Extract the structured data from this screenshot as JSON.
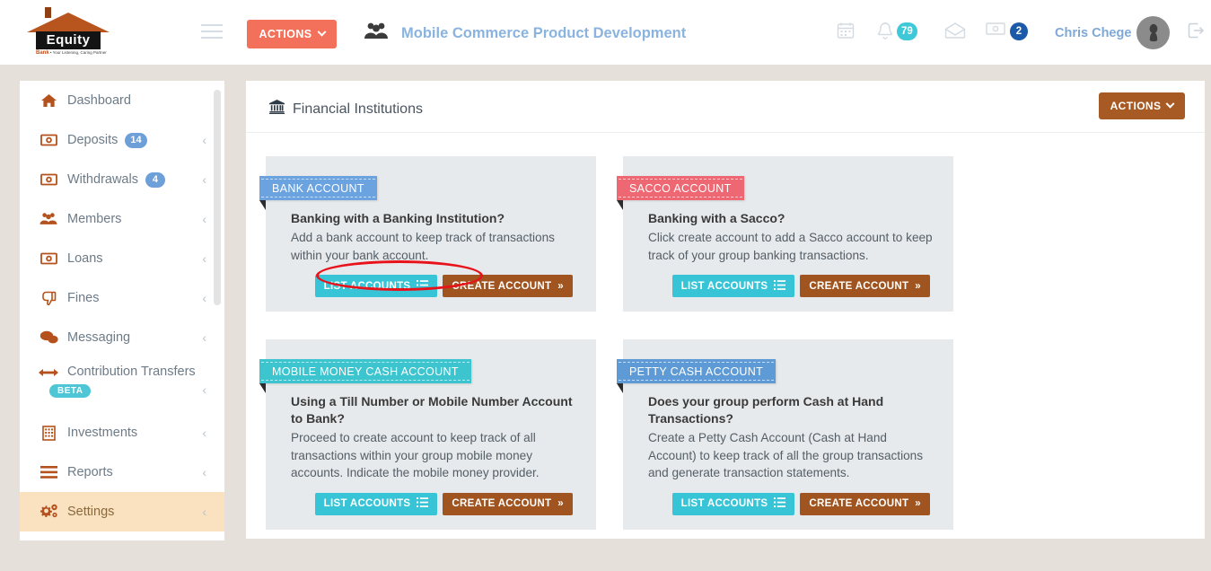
{
  "header": {
    "logo": {
      "name": "Equity",
      "tagline": "Bank",
      "tagline_rest": " • Your Listening, Caring Partner"
    },
    "menu_toggle_icon": "hamburger-icon",
    "actions_label": "ACTIONS",
    "group_icon": "users-group-icon",
    "group_title": "Mobile Commerce Product Development",
    "calendar_icon": "calendar-icon",
    "bell_icon": "bell-icon",
    "bell_badge": "79",
    "bell_badge_color": "#3ec8d8",
    "mail_icon": "envelope-open-icon",
    "money_icon": "money-bill-icon",
    "money_badge": "2",
    "money_badge_color": "#1b5aa8",
    "username": "Chris Chege",
    "avatar_icon": "user-avatar",
    "logout_icon": "sign-out-icon"
  },
  "sidebar": {
    "items": [
      {
        "label": "Dashboard",
        "icon": "home-icon",
        "badge": null,
        "chevron": false,
        "active": false,
        "beta": null
      },
      {
        "label": "Deposits",
        "icon": "money-bill-icon",
        "badge": "14",
        "chevron": true,
        "active": false,
        "beta": null
      },
      {
        "label": "Withdrawals",
        "icon": "money-bill-icon",
        "badge": "4",
        "chevron": true,
        "active": false,
        "beta": null
      },
      {
        "label": "Members",
        "icon": "users-group-icon",
        "badge": null,
        "chevron": true,
        "active": false,
        "beta": null
      },
      {
        "label": "Loans",
        "icon": "money-bill-icon",
        "badge": null,
        "chevron": true,
        "active": false,
        "beta": null
      },
      {
        "label": "Fines",
        "icon": "thumbs-down-icon",
        "badge": null,
        "chevron": true,
        "active": false,
        "beta": null
      },
      {
        "label": "Messaging",
        "icon": "comments-icon",
        "badge": null,
        "chevron": true,
        "active": false,
        "beta": null
      },
      {
        "label": "Contribution Transfers",
        "icon": "arrows-left-right-icon",
        "badge": null,
        "chevron": true,
        "active": false,
        "beta": "BETA"
      },
      {
        "label": "Investments",
        "icon": "building-icon",
        "badge": null,
        "chevron": true,
        "active": false,
        "beta": null
      },
      {
        "label": "Reports",
        "icon": "bars-icon",
        "badge": null,
        "chevron": true,
        "active": false,
        "beta": null
      },
      {
        "label": "Settings",
        "icon": "gears-icon",
        "badge": null,
        "chevron": true,
        "active": true,
        "beta": null
      }
    ]
  },
  "main": {
    "title": "Financial Institutions",
    "title_icon": "bank-institution-icon",
    "actions_label": "ACTIONS",
    "cards": [
      {
        "ribbon": "BANK ACCOUNT",
        "ribbon_color": "#6aa3e0",
        "title": "Banking with a Banking Institution?",
        "desc": "Add a bank account to keep track of transactions within your bank account.",
        "list_label": "LIST ACCOUNTS",
        "create_label": "CREATE ACCOUNT",
        "highlighted": true
      },
      {
        "ribbon": "SACCO ACCOUNT",
        "ribbon_color": "#ee6873",
        "title": "Banking with a Sacco?",
        "desc": "Click create account to add a Sacco account to keep track of your group banking transactions.",
        "list_label": "LIST ACCOUNTS",
        "create_label": "CREATE ACCOUNT",
        "highlighted": false
      },
      {
        "ribbon": "MOBILE MONEY CASH ACCOUNT",
        "ribbon_color": "#3cc4cf",
        "title": "Using a Till Number or Mobile Number Account to Bank?",
        "desc": "Proceed to create account to keep track of all transactions within your group mobile money accounts. Indicate the mobile money provider.",
        "list_label": "LIST ACCOUNTS",
        "create_label": "CREATE ACCOUNT",
        "highlighted": false
      },
      {
        "ribbon": "PETTY CASH ACCOUNT",
        "ribbon_color": "#5e9bd6",
        "title": "Does your group perform Cash at Hand Transactions?",
        "desc": "Create a Petty Cash Account (Cash at Hand Account) to keep track of all the group transactions and generate transaction statements.",
        "list_label": "LIST ACCOUNTS",
        "create_label": "CREATE ACCOUNT",
        "highlighted": false
      }
    ]
  },
  "annotation": {
    "type": "ellipse-highlight",
    "color": "#e8131a",
    "target": "list-accounts-button-bank"
  },
  "colors": {
    "page_bg": "#e5e0da",
    "accent_orange": "#f3705a",
    "brand_brown": "#a85a24",
    "teal": "#37c4d6",
    "card_bg": "#e7eaec",
    "active_nav": "#fae2c0"
  }
}
